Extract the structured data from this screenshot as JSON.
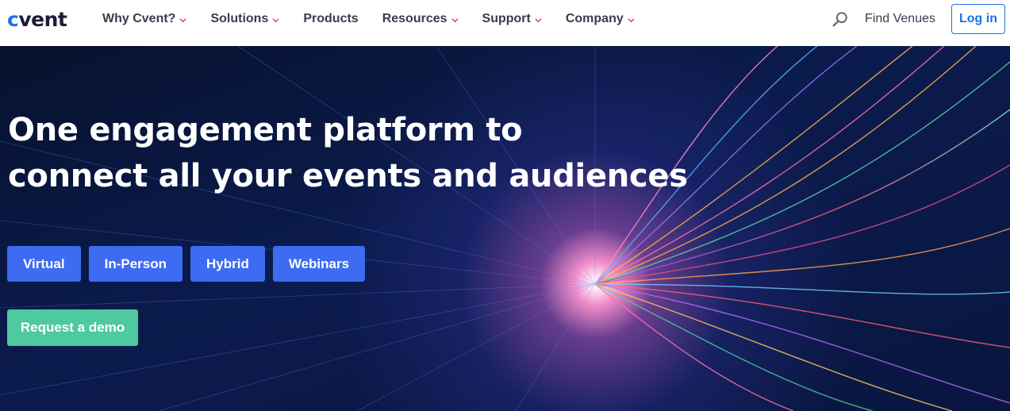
{
  "header": {
    "logo_text": "vent",
    "logo_c": "c",
    "nav": [
      {
        "label": "Why Cvent?",
        "has_dropdown": true
      },
      {
        "label": "Solutions",
        "has_dropdown": true
      },
      {
        "label": "Products",
        "has_dropdown": false
      },
      {
        "label": "Resources",
        "has_dropdown": true
      },
      {
        "label": "Support",
        "has_dropdown": true
      },
      {
        "label": "Company",
        "has_dropdown": true
      }
    ],
    "find_venues": "Find Venues",
    "login_label": "Log in",
    "search_icon": "search-icon"
  },
  "hero": {
    "headline_line1": "One engagement platform to",
    "headline_line2": "connect all your events and audiences",
    "pills": [
      "Virtual",
      "In-Person",
      "Hybrid",
      "Webinars"
    ],
    "demo_label": "Request a demo"
  },
  "colors": {
    "brand_blue": "#1a73e8",
    "pill_blue": "#3d6bf2",
    "demo_green": "#4ec9a0",
    "chevron_red": "#e0485a",
    "hero_dark": "#0b1b4d"
  }
}
